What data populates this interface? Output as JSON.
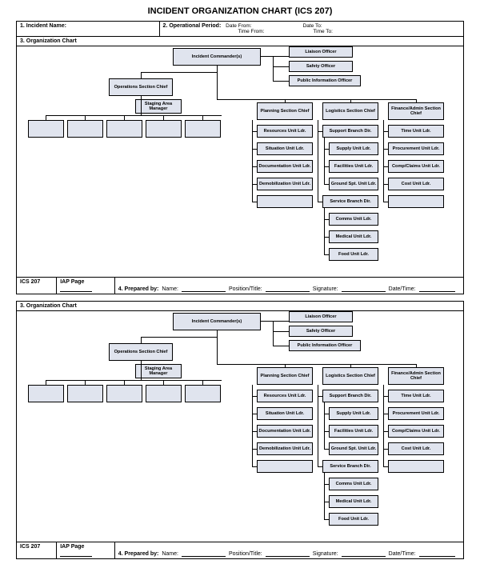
{
  "title": "INCIDENT ORGANIZATION CHART (ICS 207)",
  "header": {
    "incident_name_label": "1. Incident Name:",
    "op_period_label": "2. Operational Period:",
    "date_from": "Date From:",
    "date_to": "Date To:",
    "time_from": "Time From:",
    "time_to": "Time To:"
  },
  "section3_label": "3. Organization Chart",
  "nodes": {
    "incident_commander": "Incident Commander(s)",
    "liaison": "Liaison Officer",
    "safety": "Safety Officer",
    "pio": "Public Information Officer",
    "ops_chief": "Operations Section Chief",
    "staging": "Staging Area Manager",
    "planning_chief": "Planning Section Chief",
    "logistics_chief": "Logistics Section Chief",
    "finance_chief": "Finance/Admin Section Chief",
    "resources": "Resources Unit Ldr.",
    "situation": "Situation Unit Ldr.",
    "documentation": "Documentation Unit Ldr.",
    "demob": "Demobilization Unit Ldr.",
    "support_branch": "Support Branch Dir.",
    "supply": "Supply Unit Ldr.",
    "facilities": "Facilities Unit Ldr.",
    "ground": "Ground Spt. Unit Ldr.",
    "service_branch": "Service Branch Dir.",
    "comms": "Comms Unit Ldr.",
    "medical": "Medical Unit Ldr.",
    "food": "Food Unit Ldr.",
    "time": "Time Unit Ldr.",
    "procurement": "Procurement Unit Ldr.",
    "comp": "Comp/Claims Unit Ldr.",
    "cost": "Cost Unit Ldr."
  },
  "footer": {
    "form_id": "ICS 207",
    "iap_page": "IAP Page",
    "prepared_by_label": "4. Prepared by:",
    "name": "Name:",
    "position": "Position/Title:",
    "signature": "Signature:",
    "datetime": "Date/Time:"
  }
}
